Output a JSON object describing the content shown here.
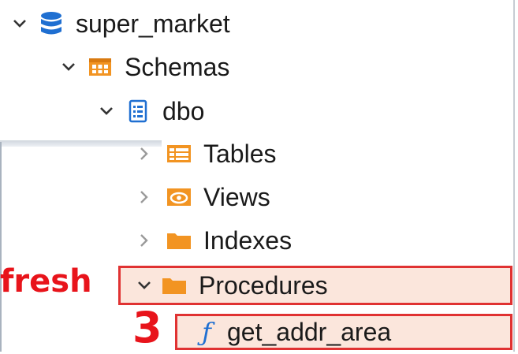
{
  "tree": {
    "database": {
      "label": "super_market",
      "icon": "database-icon"
    },
    "schemas": {
      "label": "Schemas",
      "icon": "schemas-icon"
    },
    "schema_dbo": {
      "label": "dbo",
      "icon": "schema-doc-icon"
    },
    "tables": {
      "label": "Tables",
      "icon": "tables-icon"
    },
    "views": {
      "label": "Views",
      "icon": "views-icon"
    },
    "indexes": {
      "label": "Indexes",
      "icon": "folder-icon"
    },
    "procedures": {
      "label": "Procedures",
      "icon": "folder-icon"
    },
    "procedure_item": {
      "label": "get_addr_area",
      "icon": "function-icon",
      "glyph": "ƒ"
    }
  },
  "annotations": {
    "refresh_label": "fresh",
    "step_number": "3",
    "color": "#e8141b"
  },
  "colors": {
    "accent_orange": "#f29422",
    "database_blue": "#1f6fd1",
    "highlight_bg": "#fbe6dc",
    "highlight_border": "#e03232"
  }
}
